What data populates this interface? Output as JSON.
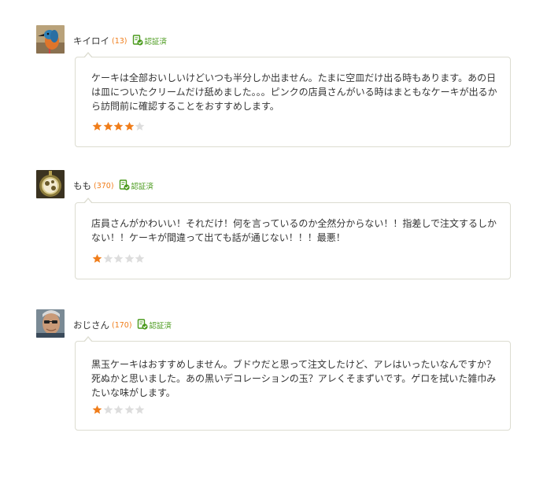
{
  "verified_label": "認証済",
  "colors": {
    "star_filled": "#f07d1a",
    "star_empty": "#dddddd",
    "count": "#f07d1a",
    "verified": "#4a9a1c",
    "border": "#dcdcd0"
  },
  "reviews": [
    {
      "username": "キイロイ",
      "count": "(13)",
      "avatar_icon": "kingfisher-bird-avatar",
      "text": "ケーキは全部おいしいけどいつも半分しか出ません。たまに空皿だけ出る時もあります。あの日は皿についたクリームだけ舐めました。。。ピンクの店員さんがいる時はまともなケーキが出るから訪問前に確認することをおすすめします。",
      "rating": 4,
      "max_rating": 5
    },
    {
      "username": "もも",
      "count": "(370)",
      "avatar_icon": "pocket-watch-avatar",
      "text": "店員さんがかわいい！それだけ！何を言っているのか全然分からない！！指差しで注文するしかない！！ケーキが間違って出ても話が通じない！！！最悪！",
      "rating": 1,
      "max_rating": 5
    },
    {
      "username": "おじさん",
      "count": "(170)",
      "avatar_icon": "man-with-glasses-avatar",
      "text": "黒玉ケーキはおすすめしません。ブドウだと思って注文したけど、アレはいったいなんですか？死ぬかと思いました。あの黒いデコレーションの玉？アレくそまずいです。ゲロを拭いた雑巾みたいな味がします。",
      "rating": 1,
      "max_rating": 5
    }
  ]
}
